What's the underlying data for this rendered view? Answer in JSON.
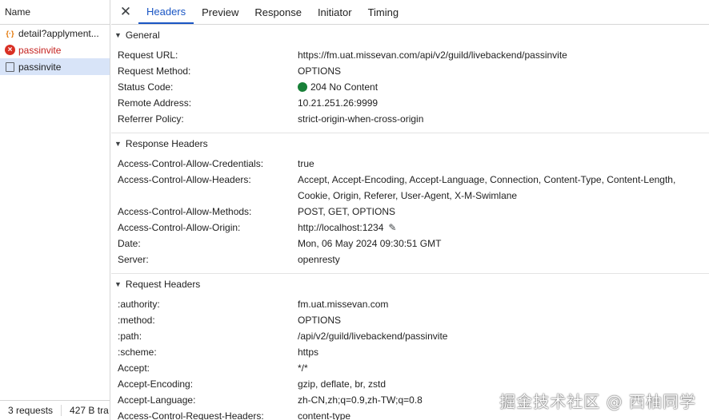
{
  "left": {
    "header": "Name",
    "requests": [
      {
        "label": "detail?applyment...",
        "icon": "json-icon",
        "type": "json"
      },
      {
        "label": "passinvite",
        "icon": "error-icon",
        "type": "error"
      },
      {
        "label": "passinvite",
        "icon": "document-icon",
        "type": "selected"
      }
    ],
    "footer": {
      "requests": "3 requests",
      "transferred": "427 B tra"
    }
  },
  "tabs": [
    "Headers",
    "Preview",
    "Response",
    "Initiator",
    "Timing"
  ],
  "active_tab": "Headers",
  "general": {
    "title": "General",
    "rows": [
      {
        "key": "Request URL:",
        "value": "https://fm.uat.missevan.com/api/v2/guild/livebackend/passinvite"
      },
      {
        "key": "Request Method:",
        "value": "OPTIONS"
      },
      {
        "key": "Status Code:",
        "value": "204 No Content"
      },
      {
        "key": "Remote Address:",
        "value": "10.21.251.26:9999"
      },
      {
        "key": "Referrer Policy:",
        "value": "strict-origin-when-cross-origin"
      }
    ]
  },
  "response_headers": {
    "title": "Response Headers",
    "rows": [
      {
        "key": "Access-Control-Allow-Credentials:",
        "value": "true"
      },
      {
        "key": "Access-Control-Allow-Headers:",
        "value": "Accept, Accept-Encoding, Accept-Language, Connection, Content-Type, Content-Length, Cookie, Origin, Referer, User-Agent, X-M-Swimlane"
      },
      {
        "key": "Access-Control-Allow-Methods:",
        "value": "POST, GET, OPTIONS"
      },
      {
        "key": "Access-Control-Allow-Origin:",
        "value": "http://localhost:1234"
      },
      {
        "key": "Date:",
        "value": "Mon, 06 May 2024 09:30:51 GMT"
      },
      {
        "key": "Server:",
        "value": "openresty"
      }
    ]
  },
  "request_headers": {
    "title": "Request Headers",
    "rows": [
      {
        "key": ":authority:",
        "value": "fm.uat.missevan.com"
      },
      {
        "key": ":method:",
        "value": "OPTIONS"
      },
      {
        "key": ":path:",
        "value": "/api/v2/guild/livebackend/passinvite"
      },
      {
        "key": ":scheme:",
        "value": "https"
      },
      {
        "key": "Accept:",
        "value": "*/*"
      },
      {
        "key": "Accept-Encoding:",
        "value": "gzip, deflate, br, zstd"
      },
      {
        "key": "Accept-Language:",
        "value": "zh-CN,zh;q=0.9,zh-TW;q=0.8"
      },
      {
        "key": "Access-Control-Request-Headers:",
        "value": "content-type"
      }
    ]
  },
  "status_color": "#188038",
  "accent": "#1a56c4",
  "watermark": "掘金技术社区 @ 西柚同学"
}
